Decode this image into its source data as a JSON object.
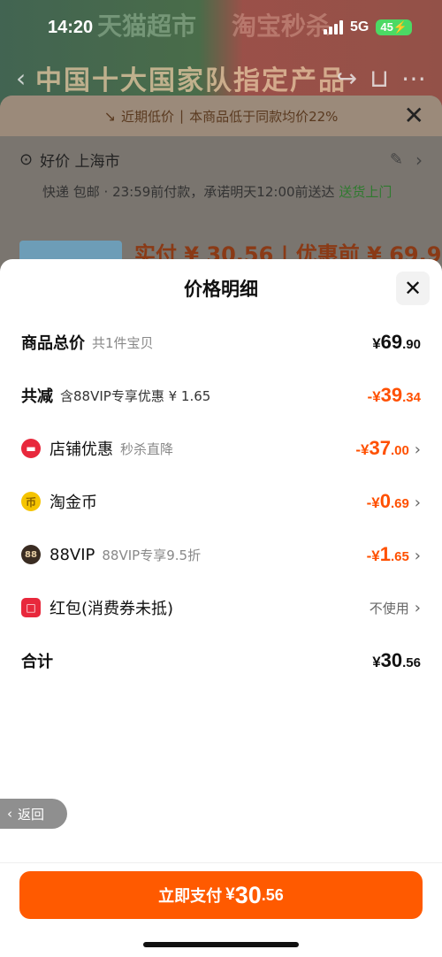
{
  "status_bar": {
    "time": "14:20",
    "network": "5G",
    "battery": "45"
  },
  "background": {
    "ad_left": "天猫超市",
    "ad_right": "淘宝秒杀",
    "banner_title": "中国十大国家队指定产品",
    "low_price_notice": "近期低价",
    "low_price_detail": "本商品低于同款均价22%",
    "address_label": "好价 上海市",
    "delivery_prefix": "快递 包邮 · 23:59前付款，承诺明天12:00前送达 ",
    "delivery_highlight": "送货上门",
    "price_line": "实付 ¥ 30.56 | 优惠前 ¥ 69.9"
  },
  "modal": {
    "title": "价格明细",
    "rows": [
      {
        "label": "商品总价",
        "sub": "共1件宝贝",
        "price": {
          "sym": "¥",
          "int": "69",
          "dec": ".90"
        }
      },
      {
        "label": "共减",
        "sub": "含88VIP专享优惠 ¥ 1.65",
        "price": {
          "sym": "-¥",
          "int": "39",
          "dec": ".34"
        }
      },
      {
        "label": "店铺优惠",
        "sub": "秒杀直降",
        "price": {
          "sym": "-¥",
          "int": "37",
          "dec": ".00"
        }
      },
      {
        "label": "淘金币",
        "sub": "",
        "price": {
          "sym": "-¥",
          "int": "0",
          "dec": ".69"
        }
      },
      {
        "label": "88VIP",
        "sub": "88VIP专享9.5折",
        "price": {
          "sym": "-¥",
          "int": "1",
          "dec": ".65"
        }
      },
      {
        "label": "红包(消费券未抵)",
        "sub": "",
        "value": "不使用"
      },
      {
        "label": "合计",
        "sub": "",
        "price": {
          "sym": "¥",
          "int": "30",
          "dec": ".56"
        }
      }
    ],
    "vip_icon_text": "88"
  },
  "back_button": "返回",
  "pay_button": {
    "label": "立即支付",
    "sym": "¥",
    "int": "30",
    "dec": ".56"
  },
  "colors": {
    "accent": "#ff5000",
    "pay_button": "#ff5a00"
  }
}
